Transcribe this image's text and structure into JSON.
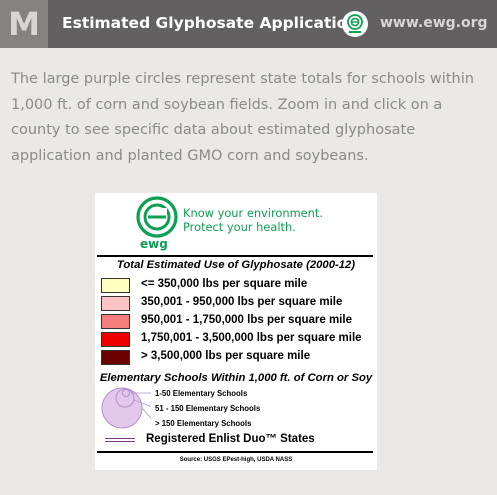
{
  "header": {
    "badge_letter": "M",
    "title": "Estimated Glyphosate Application",
    "logo_icon": "ewg-logo-icon",
    "site_url": "www.ewg.org"
  },
  "description": "The large purple circles represent state totals for schools within 1,000 ft. of corn and soybean fields. Zoom in and click on a county to see specific data about estimated glyphosate application and planted GMO corn and soybeans.",
  "legend": {
    "brand": {
      "tagline_line1": "Know your environment.",
      "tagline_line2": "Protect your health.",
      "wordmark": "ewg",
      "color": "#0d9f52"
    },
    "glyphosate_title": "Total Estimated Use of Glyphosate (2000-12)",
    "glyphosate_classes": [
      {
        "label": "<= 350,000 lbs per square mile",
        "color": "#ffffc0"
      },
      {
        "label": "350,001 - 950,000 lbs per square mile",
        "color": "#fbc3c3"
      },
      {
        "label": "950,001 - 1,750,000 lbs per square mile",
        "color": "#f47e7e"
      },
      {
        "label": "1,750,001 - 3,500,000 lbs per square mile",
        "color": "#ee0000"
      },
      {
        "label": "> 3,500,000 lbs per square mile",
        "color": "#6b0000"
      }
    ],
    "schools_title": "Elementary Schools Within 1,000 ft. of Corn or Soy",
    "school_circles": [
      {
        "label": "1-50 Elementary Schools"
      },
      {
        "label": "51 - 150 Elementary Schools"
      },
      {
        "label": "> 150 Elementary Schools"
      }
    ],
    "circle_color": "#e2c9ec",
    "circle_stroke": "#b590c8",
    "enlist_label": "Registered Enlist Duo™ States",
    "enlist_color": "#7e3c7e",
    "source": "Source: USGS EPest-high, USDA NASS"
  }
}
